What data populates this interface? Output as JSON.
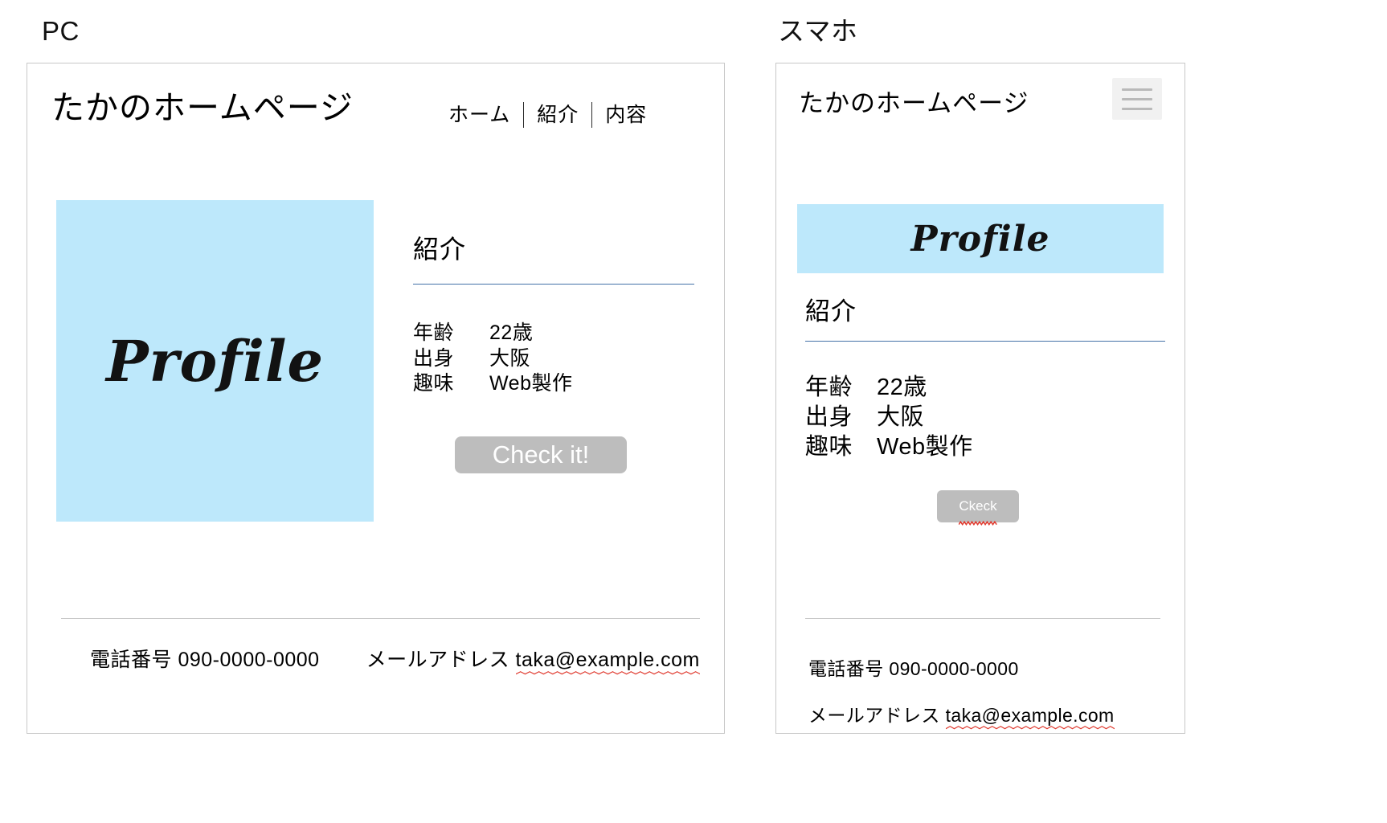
{
  "captions": {
    "pc": "PC",
    "mobile": "スマホ"
  },
  "site": {
    "title": "たかのホームページ",
    "nav": [
      {
        "label": "ホーム"
      },
      {
        "label": "紹介"
      },
      {
        "label": "内容"
      }
    ],
    "profile_image_text": "Profile",
    "section_heading": "紹介",
    "info": {
      "rows": [
        {
          "key": "年齢",
          "value": "22歳"
        },
        {
          "key": "出身",
          "value": "大阪"
        },
        {
          "key": "趣味",
          "value": "Web製作"
        }
      ]
    },
    "footer": {
      "phone_label": "電話番号",
      "phone_value": "090-0000-0000",
      "mail_label": "メールアドレス",
      "mail_value": "taka@example.com"
    }
  },
  "pc": {
    "button_label": "Check it!"
  },
  "mobile": {
    "button_label": "Ckeck",
    "menu_icon": "hamburger-icon"
  },
  "colors": {
    "profile_bg": "#bde8fb",
    "button_bg": "#bdbdbd",
    "heading_rule": "#4472a8",
    "panel_border": "#c8c8c8",
    "spellcheck_underline": "#e03a2f"
  }
}
